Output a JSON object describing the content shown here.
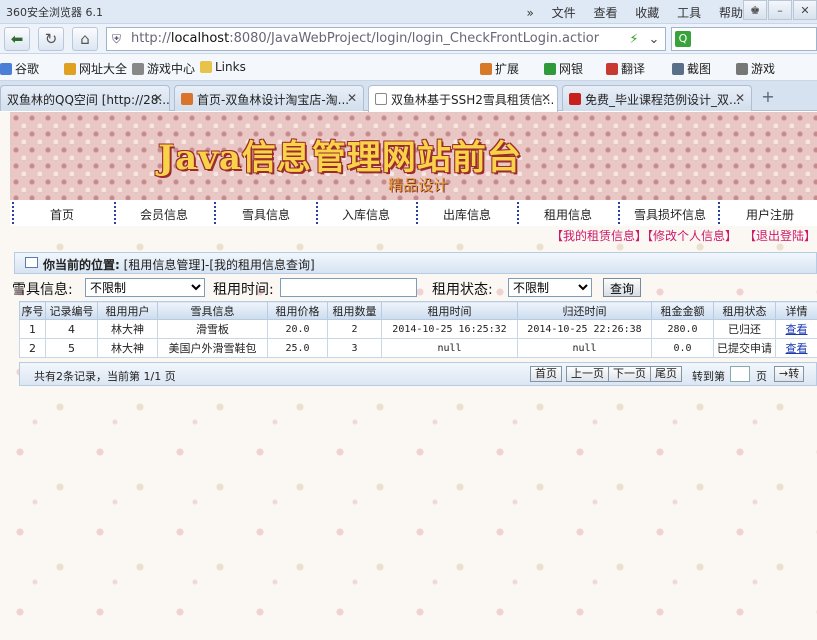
{
  "browser": {
    "app_title": "360安全浏览器 6.1",
    "menus": [
      "文件",
      "查看",
      "收藏",
      "工具",
      "帮助"
    ],
    "url_host_prefix": "http://",
    "url_host": "localhost",
    "url_rest": ":8080/JavaWebProject/login/login_CheckFrontLogin.actior",
    "favorites": [
      "谷歌",
      "网址大全",
      "游戏中心",
      "Links"
    ],
    "favorites_right": [
      "扩展",
      "网银",
      "翻译",
      "截图",
      "游戏"
    ],
    "tabs": [
      {
        "label": "双鱼林的QQ空间 [http://28...",
        "active": false
      },
      {
        "label": "首页-双鱼林设计淘宝店-淘...",
        "active": false
      },
      {
        "label": "双鱼林基于SSH2雪具租赁信...",
        "active": true
      },
      {
        "label": "免费_毕业课程范例设计_双...",
        "active": false
      }
    ]
  },
  "site": {
    "title": "Java信息管理网站前台",
    "subtitle": "精品设计",
    "nav": [
      "首页",
      "会员信息",
      "雪具信息",
      "入库信息",
      "出库信息",
      "租用信息",
      "雪具损坏信息",
      "用户注册"
    ],
    "user_links": [
      "【我的租赁信息】",
      "【修改个人信息】",
      "【退出登陆】"
    ]
  },
  "location": {
    "label": "你当前的位置:",
    "path": "[租用信息管理]-[我的租用信息查询]"
  },
  "filter": {
    "equipment_label": "雪具信息:",
    "equipment_value": "不限制",
    "time_label": "租用时间:",
    "time_value": "",
    "status_label": "租用状态:",
    "status_value": "不限制",
    "query_button": "查询"
  },
  "table": {
    "headers": [
      "序号",
      "记录编号",
      "租用用户",
      "雪具信息",
      "租用价格",
      "租用数量",
      "租用时间",
      "归还时间",
      "租金金额",
      "租用状态",
      "详情"
    ],
    "rows": [
      [
        "1",
        "4",
        "林大神",
        "滑雪板",
        "20.0",
        "2",
        "2014-10-25 16:25:32",
        "2014-10-25 22:26:38",
        "280.0",
        "已归还",
        "查看"
      ],
      [
        "2",
        "5",
        "林大神",
        "美国户外滑雪鞋包",
        "25.0",
        "3",
        "null",
        "null",
        "0.0",
        "已提交申请",
        "查看"
      ]
    ]
  },
  "pager": {
    "summary": "共有2条记录，当前第 1/1 页",
    "first": "首页",
    "prev": "上一页",
    "next": "下一页",
    "last": "尾页",
    "jump_label": "转到第",
    "page_unit": "页",
    "go": "→转"
  }
}
